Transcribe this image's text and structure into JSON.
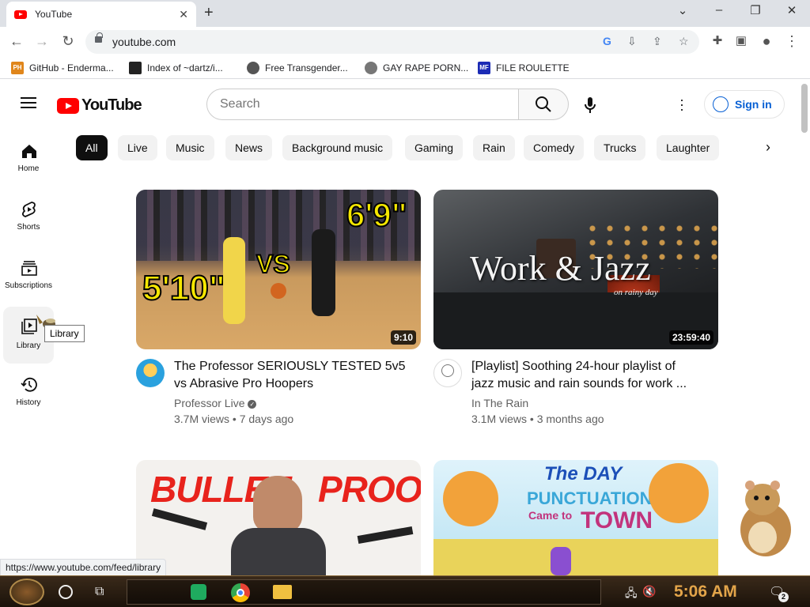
{
  "browser": {
    "tab_title": "YouTube",
    "url": "youtube.com",
    "status_url": "https://www.youtube.com/feed/library",
    "bookmarks": [
      {
        "label": "GitHub - Enderma...",
        "icon": "PH"
      },
      {
        "label": "Index of ~dartz/i...",
        "icon": "grid-icon"
      },
      {
        "label": "Free Transgender...",
        "icon": "mask-icon"
      },
      {
        "label": "GAY RAPE PORN...",
        "icon": "globe-icon"
      },
      {
        "label": "FILE ROULETTE",
        "icon": "MF"
      }
    ]
  },
  "header": {
    "logo_text": "YouTube",
    "search_placeholder": "Search",
    "signin_label": "Sign in"
  },
  "sidebar": {
    "items": [
      {
        "label": "Home"
      },
      {
        "label": "Shorts"
      },
      {
        "label": "Subscriptions"
      },
      {
        "label": "Library"
      },
      {
        "label": "History"
      }
    ],
    "tooltip": "Library"
  },
  "chips": [
    "All",
    "Live",
    "Music",
    "News",
    "Background music",
    "Gaming",
    "Rain",
    "Comedy",
    "Trucks",
    "Laughter"
  ],
  "videos": [
    {
      "title_line1": "The Professor SERIOUSLY TESTED 5v5",
      "title_line2": "vs Abrasive Pro Hoopers",
      "channel": "Professor Live",
      "meta": "3.7M views • 7 days ago",
      "duration": "9:10",
      "thumb_text1": "6'9\"",
      "thumb_text2": "VS",
      "thumb_text3": "5'10\""
    },
    {
      "title_line1": "[Playlist] Soothing 24-hour playlist of",
      "title_line2": "jazz music and rain sounds for work ...",
      "channel": "In The Rain",
      "meta": "3.1M views • 3 months ago",
      "duration": "23:59:40",
      "thumb_text1": "Work & Jazz",
      "thumb_text2": "on rainy day"
    },
    {
      "thumb_text1": "BULLET",
      "thumb_text2": "PROOF?"
    },
    {
      "thumb_text1": "The DAY",
      "thumb_text2": "PUNCTUATION",
      "thumb_text3": "Came to",
      "thumb_text4": "TOWN"
    }
  ],
  "taskbar": {
    "clock": "5:06 AM",
    "notification_count": "2"
  }
}
